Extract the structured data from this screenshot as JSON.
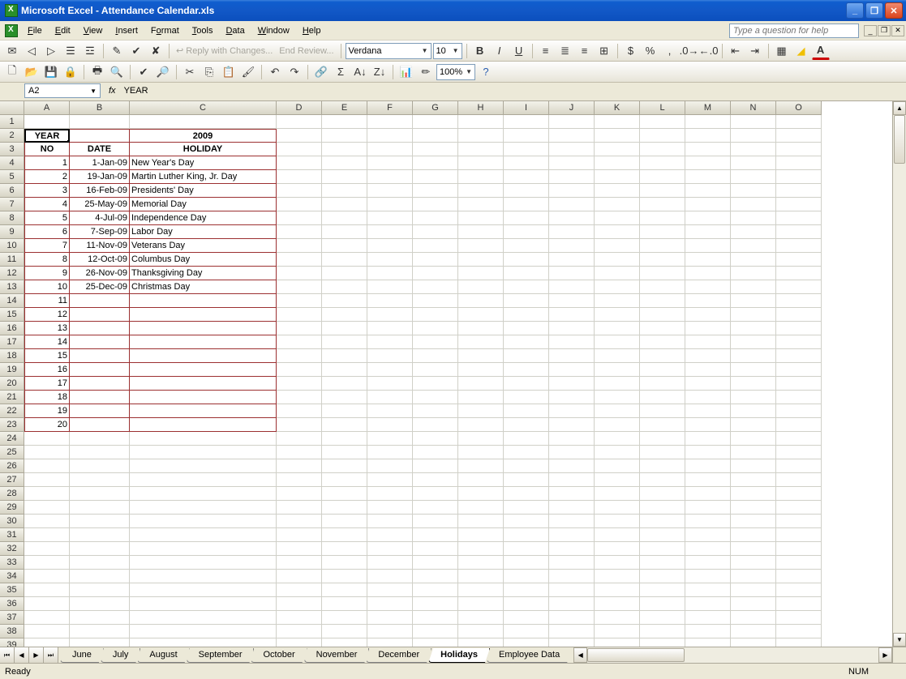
{
  "titlebar": {
    "app": "Microsoft Excel",
    "doc": "Attendance Calendar.xls"
  },
  "menus": [
    "File",
    "Edit",
    "View",
    "Insert",
    "Format",
    "Tools",
    "Data",
    "Window",
    "Help"
  ],
  "help_placeholder": "Type a question for help",
  "toolbar": {
    "reply": "Reply with Changes...",
    "end_review": "End Review...",
    "font": "Verdana",
    "size": "10",
    "zoom": "100%"
  },
  "name_box": "A2",
  "fx_label": "fx",
  "formula": "YEAR",
  "columns": [
    "A",
    "B",
    "C",
    "D",
    "E",
    "F",
    "G",
    "H",
    "I",
    "J",
    "K",
    "L",
    "M",
    "N",
    "O"
  ],
  "row_count": 41,
  "sheet": {
    "r2": {
      "A": "YEAR",
      "C": "2009"
    },
    "r3": {
      "A": "NO",
      "B": "DATE",
      "C": "HOLIDAY"
    },
    "rows": [
      {
        "no": "1",
        "date": "1-Jan-09",
        "holiday": "New Year's Day"
      },
      {
        "no": "2",
        "date": "19-Jan-09",
        "holiday": "Martin Luther King, Jr. Day"
      },
      {
        "no": "3",
        "date": "16-Feb-09",
        "holiday": "Presidents' Day"
      },
      {
        "no": "4",
        "date": "25-May-09",
        "holiday": "Memorial Day"
      },
      {
        "no": "5",
        "date": "4-Jul-09",
        "holiday": "Independence Day"
      },
      {
        "no": "6",
        "date": "7-Sep-09",
        "holiday": "Labor Day"
      },
      {
        "no": "7",
        "date": "11-Nov-09",
        "holiday": "Veterans Day"
      },
      {
        "no": "8",
        "date": "12-Oct-09",
        "holiday": "Columbus Day"
      },
      {
        "no": "9",
        "date": "26-Nov-09",
        "holiday": "Thanksgiving Day"
      },
      {
        "no": "10",
        "date": "25-Dec-09",
        "holiday": "Christmas Day"
      },
      {
        "no": "11",
        "date": "",
        "holiday": ""
      },
      {
        "no": "12",
        "date": "",
        "holiday": ""
      },
      {
        "no": "13",
        "date": "",
        "holiday": ""
      },
      {
        "no": "14",
        "date": "",
        "holiday": ""
      },
      {
        "no": "15",
        "date": "",
        "holiday": ""
      },
      {
        "no": "16",
        "date": "",
        "holiday": ""
      },
      {
        "no": "17",
        "date": "",
        "holiday": ""
      },
      {
        "no": "18",
        "date": "",
        "holiday": ""
      },
      {
        "no": "19",
        "date": "",
        "holiday": ""
      },
      {
        "no": "20",
        "date": "",
        "holiday": ""
      }
    ]
  },
  "tabs": [
    "June",
    "July",
    "August",
    "September",
    "October",
    "November",
    "December",
    "Holidays",
    "Employee Data"
  ],
  "active_tab": "Holidays",
  "status": {
    "left": "Ready",
    "num": "NUM"
  }
}
